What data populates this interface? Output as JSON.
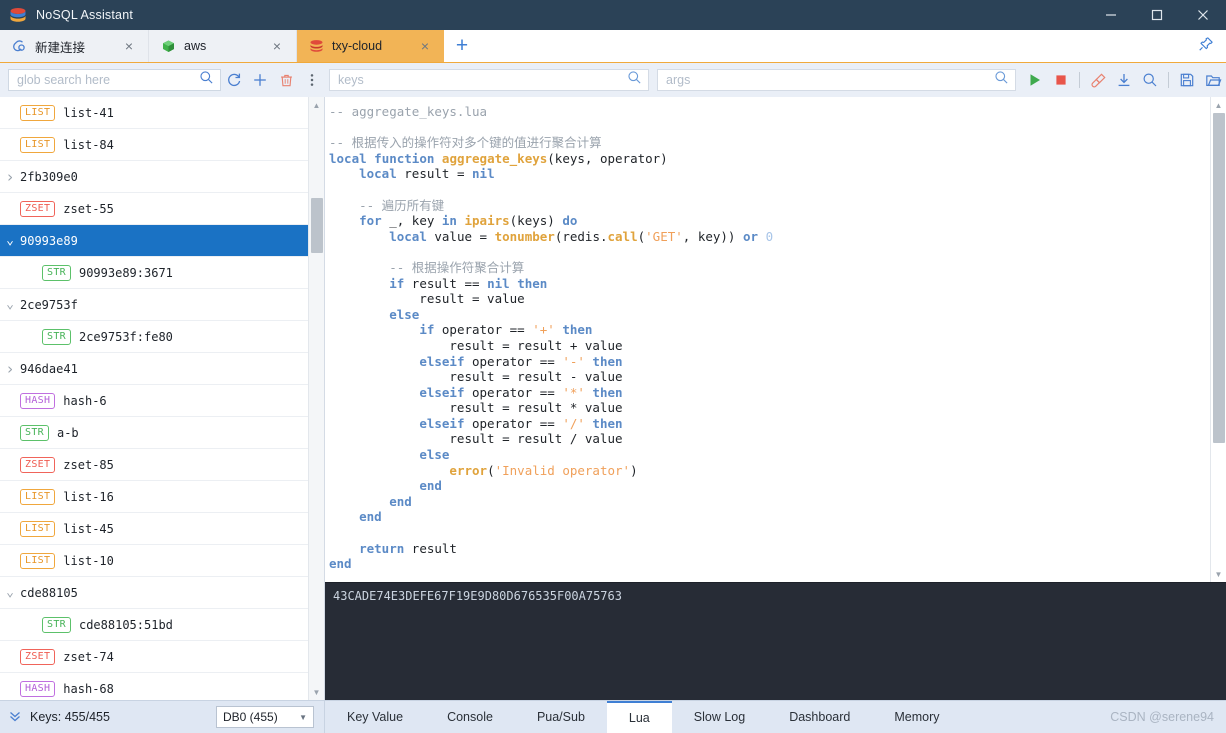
{
  "window": {
    "title": "NoSQL Assistant",
    "app_icon": "redis-stack-icon",
    "minimize": "minimize-icon",
    "maximize": "maximize-icon",
    "close": "close-icon"
  },
  "tabs": [
    {
      "label": "新建连接",
      "icon": "link-connect-icon",
      "close": "×",
      "active": false
    },
    {
      "label": "aws",
      "icon": "green-cube-icon",
      "close": "×",
      "active": false
    },
    {
      "label": "txy-cloud",
      "icon": "redis-stack-icon",
      "close": "×",
      "active": true
    }
  ],
  "tab_add_label": "+",
  "pin_icon": "pin-icon",
  "left_toolbar": {
    "search_placeholder": "glob search here",
    "search_value": "",
    "icons": [
      {
        "name": "search-icon",
        "glyph": "search"
      },
      {
        "name": "refresh-icon",
        "glyph": "refresh"
      },
      {
        "name": "add-key-icon",
        "glyph": "plus"
      },
      {
        "name": "delete-key-icon",
        "glyph": "trash"
      },
      {
        "name": "more-options-icon",
        "glyph": "kebab"
      }
    ]
  },
  "right_toolbar": {
    "keys_placeholder": "keys",
    "keys_value": "",
    "args_placeholder": "args",
    "args_value": "",
    "icons": [
      {
        "name": "args-search-icon",
        "glyph": "search"
      },
      {
        "name": "run-script-button",
        "glyph": "play"
      },
      {
        "name": "stop-script-button",
        "glyph": "stop"
      },
      {
        "name": "clear-output-button",
        "glyph": "broom"
      },
      {
        "name": "download-button",
        "glyph": "download"
      },
      {
        "name": "find-in-editor-button",
        "glyph": "search"
      },
      {
        "name": "save-script-button",
        "glyph": "save"
      },
      {
        "name": "open-script-button",
        "glyph": "folder"
      }
    ]
  },
  "keylist": [
    {
      "type": "LIST",
      "name": "list-41",
      "level": 1,
      "caret": ""
    },
    {
      "type": "LIST",
      "name": "list-84",
      "level": 1,
      "caret": ""
    },
    {
      "type": "",
      "name": "2fb309e0",
      "level": 0,
      "caret": "collapsed"
    },
    {
      "type": "ZSET",
      "name": "zset-55",
      "level": 1,
      "caret": ""
    },
    {
      "type": "",
      "name": "90993e89",
      "level": 0,
      "caret": "expanded",
      "selected": true
    },
    {
      "type": "STR",
      "name": "90993e89:3671",
      "level": 2,
      "caret": ""
    },
    {
      "type": "",
      "name": "2ce9753f",
      "level": 0,
      "caret": "expanded"
    },
    {
      "type": "STR",
      "name": "2ce9753f:fe80",
      "level": 2,
      "caret": ""
    },
    {
      "type": "",
      "name": "946dae41",
      "level": 0,
      "caret": "collapsed"
    },
    {
      "type": "HASH",
      "name": "hash-6",
      "level": 1,
      "caret": ""
    },
    {
      "type": "STR",
      "name": "a-b",
      "level": 1,
      "caret": ""
    },
    {
      "type": "ZSET",
      "name": "zset-85",
      "level": 1,
      "caret": ""
    },
    {
      "type": "LIST",
      "name": "list-16",
      "level": 1,
      "caret": ""
    },
    {
      "type": "LIST",
      "name": "list-45",
      "level": 1,
      "caret": ""
    },
    {
      "type": "LIST",
      "name": "list-10",
      "level": 1,
      "caret": ""
    },
    {
      "type": "",
      "name": "cde88105",
      "level": 0,
      "caret": "expanded"
    },
    {
      "type": "STR",
      "name": "cde88105:51bd",
      "level": 2,
      "caret": ""
    },
    {
      "type": "ZSET",
      "name": "zset-74",
      "level": 1,
      "caret": ""
    },
    {
      "type": "HASH",
      "name": "hash-68",
      "level": 1,
      "caret": ""
    }
  ],
  "editor": {
    "language": "lua",
    "filename": "aggregate_keys.lua",
    "lines": [
      [
        {
          "t": "cm",
          "s": "-- aggregate_keys.lua"
        }
      ],
      [],
      [
        {
          "t": "cm",
          "s": "-- 根据传入的操作符对多个键的值进行聚合计算"
        }
      ],
      [
        {
          "t": "kw",
          "s": "local"
        },
        {
          "t": "op",
          "s": " "
        },
        {
          "t": "kw",
          "s": "function"
        },
        {
          "t": "op",
          "s": " "
        },
        {
          "t": "fn",
          "s": "aggregate_keys"
        },
        {
          "t": "op",
          "s": "(keys, operator)"
        }
      ],
      [
        {
          "t": "op",
          "s": "    "
        },
        {
          "t": "kw",
          "s": "local"
        },
        {
          "t": "op",
          "s": " result = "
        },
        {
          "t": "kw",
          "s": "nil"
        }
      ],
      [],
      [
        {
          "t": "op",
          "s": "    "
        },
        {
          "t": "cm",
          "s": "-- 遍历所有键"
        }
      ],
      [
        {
          "t": "op",
          "s": "    "
        },
        {
          "t": "kw",
          "s": "for"
        },
        {
          "t": "op",
          "s": " _, key "
        },
        {
          "t": "kw",
          "s": "in"
        },
        {
          "t": "op",
          "s": " "
        },
        {
          "t": "fn",
          "s": "ipairs"
        },
        {
          "t": "op",
          "s": "(keys) "
        },
        {
          "t": "kw",
          "s": "do"
        }
      ],
      [
        {
          "t": "op",
          "s": "        "
        },
        {
          "t": "kw",
          "s": "local"
        },
        {
          "t": "op",
          "s": " value = "
        },
        {
          "t": "fn",
          "s": "tonumber"
        },
        {
          "t": "op",
          "s": "(redis."
        },
        {
          "t": "fn",
          "s": "call"
        },
        {
          "t": "op",
          "s": "("
        },
        {
          "t": "st",
          "s": "'GET'"
        },
        {
          "t": "op",
          "s": ", key)) "
        },
        {
          "t": "kw",
          "s": "or"
        },
        {
          "t": "op",
          "s": " "
        },
        {
          "t": "nu",
          "s": "0"
        }
      ],
      [],
      [
        {
          "t": "op",
          "s": "        "
        },
        {
          "t": "cm",
          "s": "-- 根据操作符聚合计算"
        }
      ],
      [
        {
          "t": "op",
          "s": "        "
        },
        {
          "t": "kw",
          "s": "if"
        },
        {
          "t": "op",
          "s": " result == "
        },
        {
          "t": "kw",
          "s": "nil"
        },
        {
          "t": "op",
          "s": " "
        },
        {
          "t": "kw",
          "s": "then"
        }
      ],
      [
        {
          "t": "op",
          "s": "            result = value"
        }
      ],
      [
        {
          "t": "op",
          "s": "        "
        },
        {
          "t": "kw",
          "s": "else"
        }
      ],
      [
        {
          "t": "op",
          "s": "            "
        },
        {
          "t": "kw",
          "s": "if"
        },
        {
          "t": "op",
          "s": " operator == "
        },
        {
          "t": "st",
          "s": "'+'"
        },
        {
          "t": "op",
          "s": " "
        },
        {
          "t": "kw",
          "s": "then"
        }
      ],
      [
        {
          "t": "op",
          "s": "                result = result + value"
        }
      ],
      [
        {
          "t": "op",
          "s": "            "
        },
        {
          "t": "kw",
          "s": "elseif"
        },
        {
          "t": "op",
          "s": " operator == "
        },
        {
          "t": "st",
          "s": "'-'"
        },
        {
          "t": "op",
          "s": " "
        },
        {
          "t": "kw",
          "s": "then"
        }
      ],
      [
        {
          "t": "op",
          "s": "                result = result - value"
        }
      ],
      [
        {
          "t": "op",
          "s": "            "
        },
        {
          "t": "kw",
          "s": "elseif"
        },
        {
          "t": "op",
          "s": " operator == "
        },
        {
          "t": "st",
          "s": "'*'"
        },
        {
          "t": "op",
          "s": " "
        },
        {
          "t": "kw",
          "s": "then"
        }
      ],
      [
        {
          "t": "op",
          "s": "                result = result * value"
        }
      ],
      [
        {
          "t": "op",
          "s": "            "
        },
        {
          "t": "kw",
          "s": "elseif"
        },
        {
          "t": "op",
          "s": " operator == "
        },
        {
          "t": "st",
          "s": "'/'"
        },
        {
          "t": "op",
          "s": " "
        },
        {
          "t": "kw",
          "s": "then"
        }
      ],
      [
        {
          "t": "op",
          "s": "                result = result / value"
        }
      ],
      [
        {
          "t": "op",
          "s": "            "
        },
        {
          "t": "kw",
          "s": "else"
        }
      ],
      [
        {
          "t": "op",
          "s": "                "
        },
        {
          "t": "fn",
          "s": "error"
        },
        {
          "t": "op",
          "s": "("
        },
        {
          "t": "st",
          "s": "'Invalid operator'"
        },
        {
          "t": "op",
          "s": ")"
        }
      ],
      [
        {
          "t": "op",
          "s": "            "
        },
        {
          "t": "kw",
          "s": "end"
        }
      ],
      [
        {
          "t": "op",
          "s": "        "
        },
        {
          "t": "kw",
          "s": "end"
        }
      ],
      [
        {
          "t": "op",
          "s": "    "
        },
        {
          "t": "kw",
          "s": "end"
        }
      ],
      [],
      [
        {
          "t": "op",
          "s": "    "
        },
        {
          "t": "kw",
          "s": "return"
        },
        {
          "t": "op",
          "s": " result"
        }
      ],
      [
        {
          "t": "kw",
          "s": "end"
        }
      ]
    ]
  },
  "console": {
    "output": "43CADE74E3DEFE67F19E9D80D676535F00A75763"
  },
  "statusbar": {
    "expand_icon": "double-chevron-down-icon",
    "keys_count": "Keys: 455/455",
    "db_selected": "DB0 (455)",
    "tabs": [
      {
        "label": "Key Value",
        "active": false
      },
      {
        "label": "Console",
        "active": false
      },
      {
        "label": "Pua/Sub",
        "active": false
      },
      {
        "label": "Lua",
        "active": true
      },
      {
        "label": "Slow Log",
        "active": false
      },
      {
        "label": "Dashboard",
        "active": false
      },
      {
        "label": "Memory",
        "active": false
      }
    ],
    "watermark": "CSDN @serene94"
  },
  "colors": {
    "titlebar_bg": "#2b4257",
    "active_tab_bg": "#f2b456",
    "accent_blue": "#3f7fd4",
    "selection_blue": "#1a72c4",
    "console_bg": "#272c36",
    "statusbar_bg": "#dfe7f3",
    "run_green": "#3faa4e",
    "stop_red": "#e8554a"
  }
}
